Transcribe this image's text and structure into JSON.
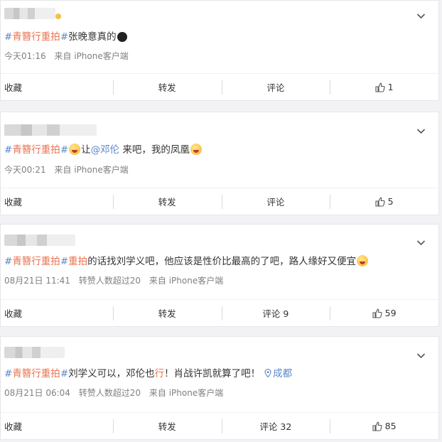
{
  "posts": [
    {
      "tag": "青簪行重拍",
      "text": "张晚意真的",
      "time": "今天01:16",
      "source": "来自 iPhone客户端",
      "actions": {
        "favorite": "收藏",
        "repost": "转发",
        "comment": "评论",
        "likes": "1"
      }
    },
    {
      "tag": "青簪行重拍",
      "text_prefix": "让",
      "mention": "@邓伦",
      "text_suffix": " 来吧，我的凤凰",
      "time": "今天00:21",
      "source": "来自 iPhone客户端",
      "actions": {
        "favorite": "收藏",
        "repost": "转发",
        "comment": "评论",
        "likes": "5"
      }
    },
    {
      "tag": "青簪行重拍",
      "tag_inline": "重拍",
      "text": "的话找刘学义吧，他应该是性价比最高的了吧，路人缘好又便宜",
      "time": "08月21日 11:41",
      "reposts_note": "转赞人数超过20",
      "source": "来自 iPhone客户端",
      "actions": {
        "favorite": "收藏",
        "repost": "转发",
        "comment": "评论 9",
        "likes": "59"
      }
    },
    {
      "tag": "青簪行重拍",
      "text_before": "刘学义可以，邓伦也",
      "highlight": "行",
      "text_after": "！肖战许凯就算了吧！",
      "location": "成都",
      "time": "08月21日 06:04",
      "reposts_note": "转赞人数超过20",
      "source": "来自 iPhone客户端",
      "actions": {
        "favorite": "收藏",
        "repost": "转发",
        "comment": "评论 32",
        "likes": "85"
      }
    }
  ],
  "icons": {
    "chevron": "chevron-down-icon",
    "like": "thumbs-up-icon",
    "location": "location-pin-icon"
  },
  "colors": {
    "topic": "#eb7350",
    "link": "#5b87c6",
    "meta": "#808080",
    "background": "#f2f2f5"
  }
}
